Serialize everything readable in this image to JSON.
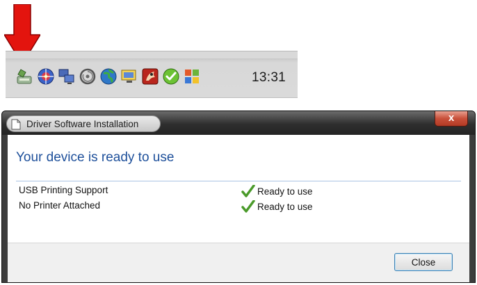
{
  "tray": {
    "clock": "13:31",
    "icons": [
      "usb-device-icon",
      "network-icon",
      "monitors-icon",
      "volume-icon",
      "globe-icon",
      "display-icon",
      "security-icon",
      "status-ok-icon",
      "windows-icon"
    ]
  },
  "dialog": {
    "title": "Driver Software Installation",
    "close_glyph": "x",
    "heading": "Your device is ready to use",
    "rows": [
      {
        "label": "USB Printing Support",
        "status": "Ready to use"
      },
      {
        "label": "No Printer Attached",
        "status": "Ready to use"
      }
    ],
    "close_button_label": "Close"
  },
  "colors": {
    "arrow": "#e3140e",
    "heading": "#1d4f9a",
    "check": "#4a9a2a",
    "close_red": "#c9503a"
  }
}
